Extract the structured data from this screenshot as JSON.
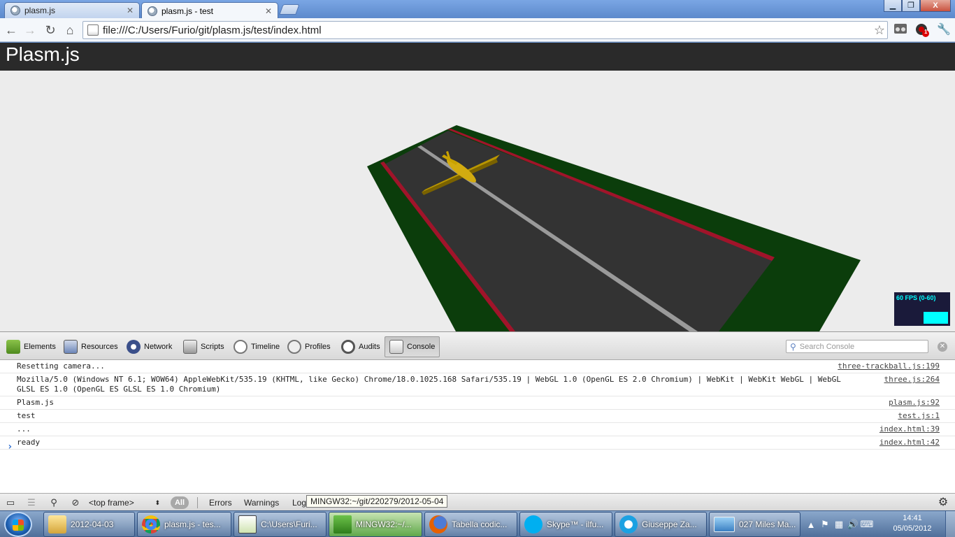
{
  "browser": {
    "tabs": [
      {
        "title": "plasm.js",
        "active": false
      },
      {
        "title": "plasm.js - test",
        "active": true
      }
    ],
    "window_buttons": {
      "minimize": "▁",
      "maximize": "❐",
      "close": "X"
    },
    "url": "file:///C:/Users/Furio/git/plasm.js/test/index.html",
    "icons": [
      "back-icon",
      "forward-icon",
      "reload-icon",
      "home-icon",
      "star-icon",
      "extension-icon",
      "notification-icon",
      "wrench-icon"
    ],
    "notification_badge": "1"
  },
  "page": {
    "title": "Plasm.js",
    "fps_label": "60 FPS (0-60)",
    "colors": {
      "ground": "#0b3d0b",
      "runway": "#333333",
      "edge": "#a0142a",
      "centerline": "#9a9a9a",
      "plane": "#c8a000"
    }
  },
  "devtools": {
    "panels": [
      "Elements",
      "Resources",
      "Network",
      "Scripts",
      "Timeline",
      "Profiles",
      "Audits",
      "Console"
    ],
    "selected_panel": "Console",
    "search_placeholder": "Search Console",
    "messages": [
      {
        "text": "Resetting camera...",
        "source": "three-trackball.js:199"
      },
      {
        "text": "Mozilla/5.0 (Windows NT 6.1; WOW64) AppleWebKit/535.19 (KHTML, like Gecko) Chrome/18.0.1025.168 Safari/535.19 | WebGL 1.0 (OpenGL ES 2.0 Chromium) | WebKit | WebKit WebGL | WebGL GLSL ES 1.0 (OpenGL ES GLSL ES 1.0 Chromium)",
        "source": "three.js:264"
      },
      {
        "text": "Plasm.js",
        "source": "plasm.js:92"
      },
      {
        "text": "test",
        "source": "test.js:1"
      },
      {
        "text": "...",
        "source": "index.html:39"
      },
      {
        "text": "ready",
        "source": "index.html:42"
      }
    ],
    "prompt": "›",
    "statusbar": {
      "frame": "<top frame>",
      "filters": [
        "All",
        "Errors",
        "Warnings",
        "Log"
      ],
      "tooltip": "MINGW32:~/git/220279/2012-05-04"
    }
  },
  "taskbar": {
    "items": [
      {
        "label": "2012-04-03",
        "icon": "folder-icon"
      },
      {
        "label": "plasm.js - tes...",
        "icon": "chrome-icon"
      },
      {
        "label": "C:\\Users\\Furi...",
        "icon": "notepad-icon"
      },
      {
        "label": "MINGW32:~/...",
        "icon": "git-icon"
      },
      {
        "label": "Tabella codic...",
        "icon": "firefox-icon"
      },
      {
        "label": "Skype™ - ilfu...",
        "icon": "skype-icon"
      },
      {
        "label": "Giuseppe Za...",
        "icon": "chat-icon"
      },
      {
        "label": "027 Miles Ma...",
        "icon": "image-viewer-icon"
      }
    ],
    "clock_time": "14:41",
    "clock_date": "05/05/2012"
  }
}
